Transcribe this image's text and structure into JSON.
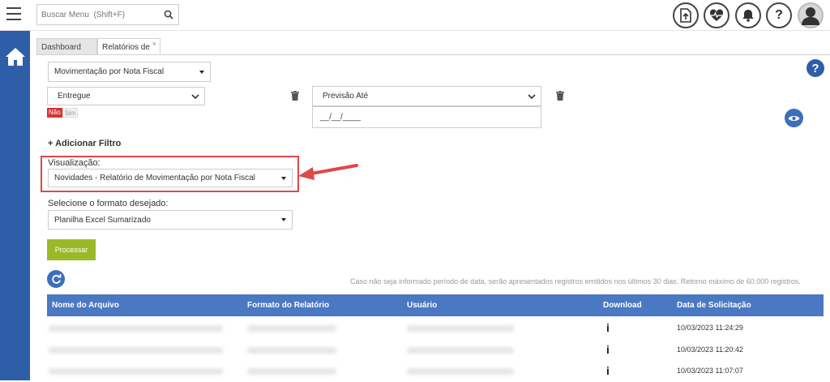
{
  "header": {
    "search_placeholder": "Buscar Menu  (Shift+F)",
    "icons": [
      "upload-icon",
      "heartbeat-icon",
      "bell-icon",
      "help-icon",
      "user-avatar-icon"
    ]
  },
  "tabs": [
    {
      "label": "Dashboard"
    },
    {
      "label": "Relatórios de",
      "close": "×"
    }
  ],
  "filters": {
    "report_select": "Movimentação por Nota Fiscal",
    "status_select": "Entregue",
    "toggle_no": "Não",
    "toggle_yes": "Sim",
    "forecast_select": "Previsão Até",
    "date_placeholder": "__/__/____",
    "add_filter": "+ Adicionar Filtro"
  },
  "visualization": {
    "label": "Visualização:",
    "value": "Novidades - Relatório de Movimentação por Nota Fiscal"
  },
  "format": {
    "label": "Selecione o formato desejado:",
    "value": "Planilha Excel Sumarizado"
  },
  "process_button": "Processar",
  "note": "Caso não seja informado período de data, serão apresentados registros emitidos nos últimos 30 dias. Retorno máximo de 60.000 registros.",
  "table": {
    "columns": [
      "Nome do Arquivo",
      "Formato do Relatório",
      "Usuário",
      "Download",
      "Data de Solicitação"
    ],
    "rows": [
      {
        "download": "i",
        "date": "10/03/2023 11:24:29"
      },
      {
        "download": "i",
        "date": "10/03/2023 11:20:42"
      },
      {
        "download": "i",
        "date": "10/03/2023 11:07:07"
      }
    ]
  },
  "colors": {
    "sidebar": "#2e5ea8",
    "table_header": "#4a78c2",
    "process_button": "#9ab929",
    "highlight": "#e04848"
  }
}
